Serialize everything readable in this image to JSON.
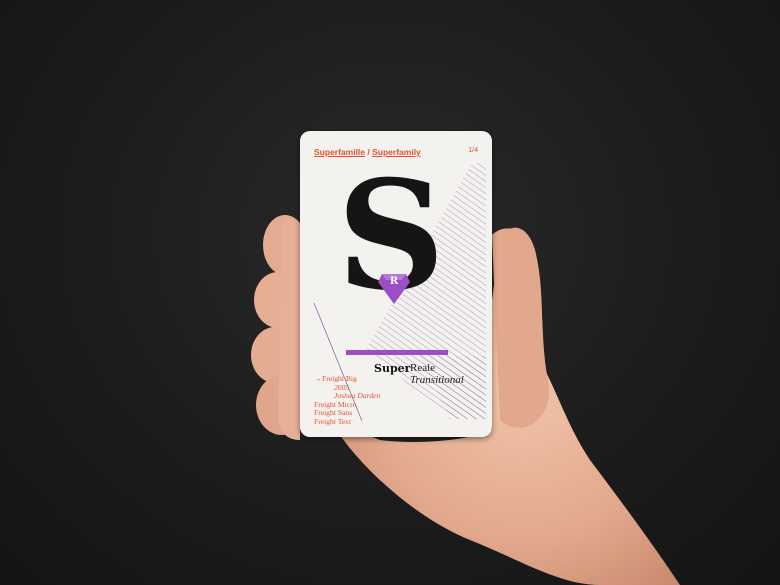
{
  "card": {
    "header": {
      "part1": "Superfamille",
      "separator": " / ",
      "part2": "Superfamily"
    },
    "index": "1/4",
    "big_letter": "S",
    "gem_letter": "R",
    "name_bold": "Super",
    "name_regular": "Reale",
    "classification": "Transitional",
    "list": {
      "arrow": "→",
      "selected": "Freight Big",
      "year": "2005",
      "designer": "Joshua Darden",
      "others": [
        "Freight Micro",
        "Freight Sans",
        "Freight Text"
      ]
    }
  },
  "colors": {
    "accent": "#e0532d",
    "purple": "#9b4fc6",
    "hatch": "#7a5a9a",
    "skin": "#e9b9a0"
  }
}
